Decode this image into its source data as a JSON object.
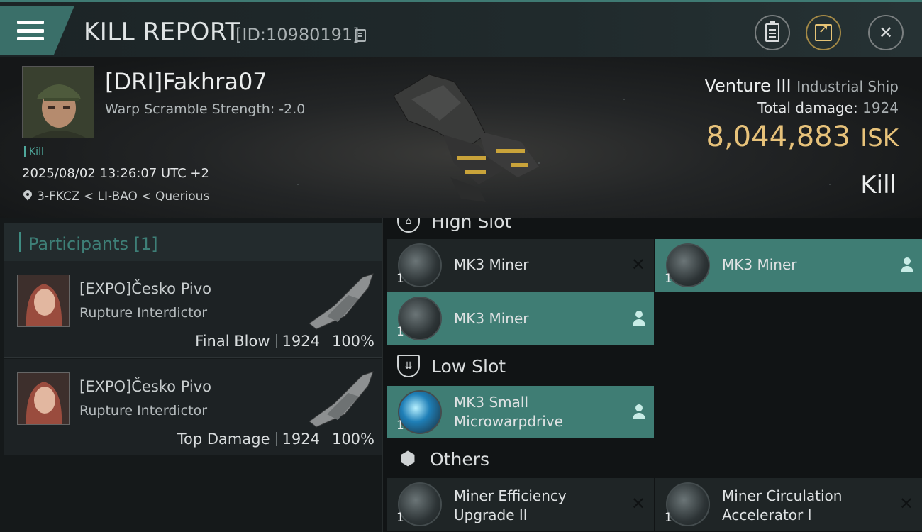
{
  "header": {
    "title": "KILL REPORT",
    "report_id": "[ID:10980191]"
  },
  "victim": {
    "name": "[DRI]Fakhra07",
    "warp_scramble": "Warp Scramble Strength: -2.0",
    "tag": "Kill",
    "datetime": "2025/08/02 13:26:07 UTC +2",
    "location": "3-FKCZ < LI-BAO < Querious",
    "ship_name": "Venture III",
    "ship_class": "Industrial Ship",
    "total_damage_label": "Total damage:",
    "total_damage": "1924",
    "isk_value": "8,044,883",
    "isk_unit": "ISK",
    "result": "Kill"
  },
  "participants": {
    "heading": "Participants [1]",
    "rows": [
      {
        "name": "[EXPO]Česko Pivo",
        "ship": "Rupture Interdictor",
        "role": "Final Blow",
        "damage": "1924",
        "percent": "100%"
      },
      {
        "name": "[EXPO]Česko Pivo",
        "ship": "Rupture Interdictor",
        "role": "Top Damage",
        "damage": "1924",
        "percent": "100%"
      }
    ]
  },
  "fitting": {
    "high_slot": "High Slot",
    "low_slot": "Low Slot",
    "others": "Others",
    "modules": [
      {
        "line1": "MK3 Miner",
        "line2": "",
        "qty": "1",
        "status": "destroyed"
      },
      {
        "line1": "MK3 Miner",
        "line2": "",
        "qty": "1",
        "status": "dropped"
      },
      {
        "line1": "MK3 Miner",
        "line2": "",
        "qty": "1",
        "status": "dropped"
      },
      {
        "line1": "MK3 Small",
        "line2": "Microwarpdrive",
        "qty": "1",
        "status": "dropped"
      },
      {
        "line1": "Miner Efficiency",
        "line2": "Upgrade II",
        "qty": "1",
        "status": "destroyed"
      },
      {
        "line1": "Miner Circulation",
        "line2": "Accelerator I",
        "qty": "1",
        "status": "destroyed"
      }
    ]
  },
  "colors": {
    "accent": "#3f7d74",
    "isk": "#e7c27a"
  }
}
